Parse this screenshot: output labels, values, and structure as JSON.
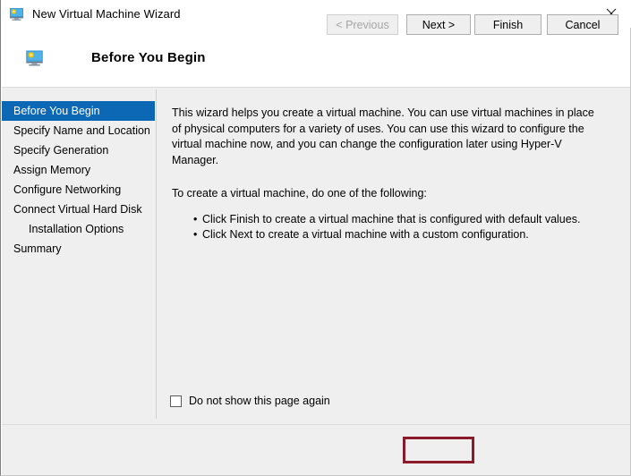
{
  "window": {
    "title": "New Virtual Machine Wizard",
    "title_icon": "virtual-machine-monitor-icon",
    "close_label": "✕"
  },
  "header": {
    "icon": "virtual-machine-monitor-icon",
    "title": "Before You Begin"
  },
  "sidebar": {
    "items": [
      {
        "label": "Before You Begin",
        "selected": true,
        "indented": false
      },
      {
        "label": "Specify Name and Location",
        "selected": false,
        "indented": false
      },
      {
        "label": "Specify Generation",
        "selected": false,
        "indented": false
      },
      {
        "label": "Assign Memory",
        "selected": false,
        "indented": false
      },
      {
        "label": "Configure Networking",
        "selected": false,
        "indented": false
      },
      {
        "label": "Connect Virtual Hard Disk",
        "selected": false,
        "indented": false
      },
      {
        "label": "Installation Options",
        "selected": false,
        "indented": true
      },
      {
        "label": "Summary",
        "selected": false,
        "indented": false
      }
    ]
  },
  "main": {
    "intro": "This wizard helps you create a virtual machine. You can use virtual machines in place of physical computers for a variety of uses. You can use this wizard to configure the virtual machine now, and you can change the configuration later using Hyper-V Manager.",
    "action_lead": "To create a virtual machine, do one of the following:",
    "actions": [
      "Click Finish to create a virtual machine that is configured with default values.",
      "Click Next to create a virtual machine with a custom configuration."
    ]
  },
  "checkbox": {
    "label": "Do not show this page again",
    "checked": false
  },
  "footer": {
    "previous_label": "< Previous",
    "previous_disabled": true,
    "next_label": "Next >",
    "finish_label": "Finish",
    "cancel_label": "Cancel"
  },
  "annotation": {
    "highlighted_control": "Next >",
    "highlight_color": "#8b1a2b"
  },
  "colors": {
    "selection_blue": "#0c68b5",
    "panel_gray": "#efefef",
    "titlebar_white": "#ffffff",
    "divider_gray": "#dcdcdc"
  }
}
